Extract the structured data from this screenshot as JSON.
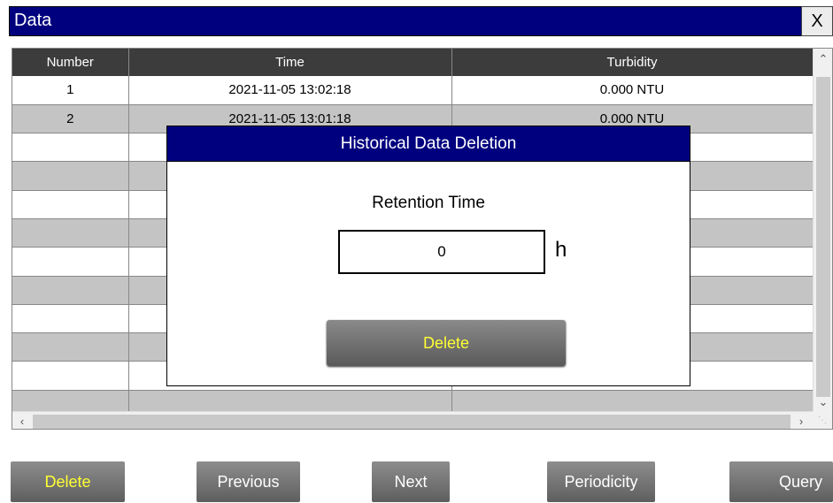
{
  "window": {
    "title": "Data",
    "close_label": "X"
  },
  "table": {
    "columns": [
      "Number",
      "Time",
      "Turbidity"
    ],
    "rows": [
      [
        "1",
        "2021-11-05 13:02:18",
        "0.000 NTU"
      ],
      [
        "2",
        "2021-11-05 13:01:18",
        "0.000 NTU"
      ],
      [
        "",
        "",
        ""
      ],
      [
        "",
        "",
        ""
      ],
      [
        "",
        "",
        ""
      ],
      [
        "",
        "",
        ""
      ],
      [
        "",
        "",
        ""
      ],
      [
        "",
        "",
        ""
      ],
      [
        "",
        "",
        ""
      ],
      [
        "",
        "",
        ""
      ],
      [
        "",
        "",
        ""
      ],
      [
        "",
        "",
        ""
      ]
    ]
  },
  "dialog": {
    "title": "Historical Data Deletion",
    "retention_label": "Retention Time",
    "retention_value": "0",
    "unit": "h",
    "delete_label": "Delete"
  },
  "toolbar": {
    "delete_label": "Delete",
    "previous_label": "Previous",
    "next_label": "Next",
    "periodicity_label": "Periodicity",
    "query_label": "Query"
  },
  "icons": {
    "scroll_up": "chevron-up-icon",
    "scroll_down": "chevron-down-icon",
    "scroll_left": "chevron-left-icon",
    "scroll_right": "chevron-right-icon"
  },
  "colors": {
    "title_bar": "#00007f",
    "header_row": "#3c3c3c",
    "alt_row": "#c4c4c4",
    "delete_text": "#ffff33"
  }
}
